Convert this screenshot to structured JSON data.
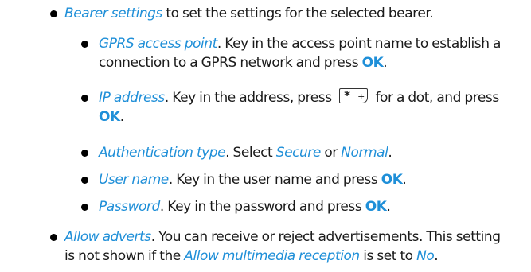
{
  "items": [
    {
      "lines": [
        [
          {
            "t": "term",
            "v": "Bearer settings"
          },
          {
            "t": "text",
            "v": " to set the settings for the selected bearer."
          }
        ]
      ]
    },
    {
      "lines": [
        [
          {
            "t": "term",
            "v": "GPRS access point"
          },
          {
            "t": "text",
            "v": ". Key in the access point name to establish a"
          }
        ],
        [
          {
            "t": "text",
            "v": "connection to a GPRS network and press "
          },
          {
            "t": "key",
            "v": "OK"
          },
          {
            "t": "text",
            "v": "."
          }
        ]
      ]
    },
    {
      "lines": [
        [
          {
            "t": "term",
            "v": "IP address"
          },
          {
            "t": "text",
            "v": ". Key in the address, press "
          },
          {
            "t": "keycap",
            "main": "*",
            "sub": "+"
          },
          {
            "t": "text",
            "v": " for a dot, and press"
          }
        ],
        [
          {
            "t": "key",
            "v": "OK"
          },
          {
            "t": "text",
            "v": "."
          }
        ]
      ]
    },
    {
      "lines": [
        [
          {
            "t": "term",
            "v": "Authentication type"
          },
          {
            "t": "text",
            "v": ". Select "
          },
          {
            "t": "term",
            "v": "Secure"
          },
          {
            "t": "text",
            "v": " or "
          },
          {
            "t": "term",
            "v": "Normal"
          },
          {
            "t": "text",
            "v": "."
          }
        ]
      ]
    },
    {
      "lines": [
        [
          {
            "t": "term",
            "v": "User name"
          },
          {
            "t": "text",
            "v": ". Key in the user name and press "
          },
          {
            "t": "key",
            "v": "OK"
          },
          {
            "t": "text",
            "v": "."
          }
        ]
      ]
    },
    {
      "lines": [
        [
          {
            "t": "term",
            "v": "Password"
          },
          {
            "t": "text",
            "v": ". Key in the password and press "
          },
          {
            "t": "key",
            "v": "OK"
          },
          {
            "t": "text",
            "v": "."
          }
        ]
      ]
    },
    {
      "lines": [
        [
          {
            "t": "term",
            "v": "Allow adverts"
          },
          {
            "t": "text",
            "v": ". You can receive or reject advertisements.  This setting"
          }
        ],
        [
          {
            "t": "text",
            "v": "is not shown if the "
          },
          {
            "t": "term",
            "v": "Allow multimedia reception"
          },
          {
            "t": "text",
            "v": " is set to "
          },
          {
            "t": "term",
            "v": "No"
          },
          {
            "t": "text",
            "v": "."
          }
        ]
      ]
    }
  ],
  "icons": {
    "bullet": "bullet-dot",
    "keycap": "star-plus-key-icon"
  },
  "colors": {
    "term": "#1f8fd8",
    "text": "#1a1a1a"
  }
}
